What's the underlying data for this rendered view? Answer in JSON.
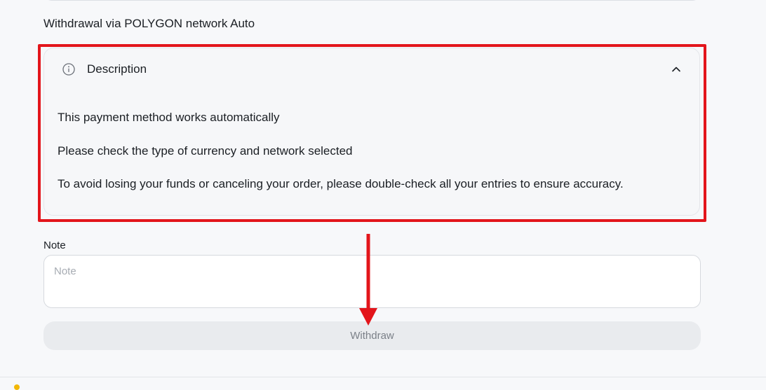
{
  "method_title": "Withdrawal via POLYGON network Auto",
  "description": {
    "label": "Description",
    "lines": [
      "This payment method works automatically",
      "Please check the type of currency and network selected",
      "To avoid losing your funds or canceling your order, please double-check all your entries to ensure accuracy."
    ]
  },
  "note": {
    "label": "Note",
    "placeholder": "Note",
    "value": ""
  },
  "withdraw_button": "Withdraw",
  "annotation_color": "#e3151b",
  "icons": {
    "info": "info-circle-icon",
    "collapse": "chevron-up-icon"
  }
}
